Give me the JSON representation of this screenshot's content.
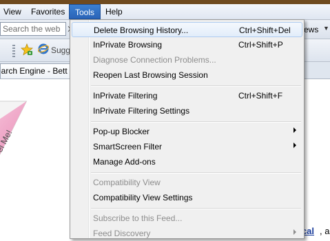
{
  "menubar": {
    "items": [
      {
        "label": "View"
      },
      {
        "label": "Favorites"
      },
      {
        "label": "Tools"
      },
      {
        "label": "Help"
      }
    ]
  },
  "toolbar": {
    "search_placeholder": "Search the web",
    "news_label": "ews",
    "favorites_suggestion": "Sugg"
  },
  "tab": {
    "title": "earch Engine - Bett"
  },
  "page": {
    "peel_text": "el Me!",
    "link_text": "ocal",
    "link_tail": ", a"
  },
  "tools_menu": {
    "items": [
      {
        "label": "Delete Browsing History...",
        "shortcut": "Ctrl+Shift+Del",
        "disabled": false,
        "highlighted": true,
        "submenu": false
      },
      {
        "label": "InPrivate Browsing",
        "shortcut": "Ctrl+Shift+P",
        "disabled": false,
        "highlighted": false,
        "submenu": false
      },
      {
        "label": "Diagnose Connection Problems...",
        "shortcut": "",
        "disabled": true,
        "highlighted": false,
        "submenu": false
      },
      {
        "label": "Reopen Last Browsing Session",
        "shortcut": "",
        "disabled": false,
        "highlighted": false,
        "submenu": false
      },
      {
        "label": "InPrivate Filtering",
        "shortcut": "Ctrl+Shift+F",
        "disabled": false,
        "highlighted": false,
        "submenu": false
      },
      {
        "label": "InPrivate Filtering Settings",
        "shortcut": "",
        "disabled": false,
        "highlighted": false,
        "submenu": false
      },
      {
        "label": "Pop-up Blocker",
        "shortcut": "",
        "disabled": false,
        "highlighted": false,
        "submenu": true
      },
      {
        "label": "SmartScreen Filter",
        "shortcut": "",
        "disabled": false,
        "highlighted": false,
        "submenu": true
      },
      {
        "label": "Manage Add-ons",
        "shortcut": "",
        "disabled": false,
        "highlighted": false,
        "submenu": false
      },
      {
        "label": "Compatibility View",
        "shortcut": "",
        "disabled": true,
        "highlighted": false,
        "submenu": false
      },
      {
        "label": "Compatibility View Settings",
        "shortcut": "",
        "disabled": false,
        "highlighted": false,
        "submenu": false
      },
      {
        "label": "Subscribe to this Feed...",
        "shortcut": "",
        "disabled": true,
        "highlighted": false,
        "submenu": false
      },
      {
        "label": "Feed Discovery",
        "shortcut": "",
        "disabled": true,
        "highlighted": false,
        "submenu": true
      }
    ]
  },
  "colors": {
    "menu_active_bg": "#2a64b8",
    "disabled_text": "#8d8d8d",
    "link": "#1a3d9b"
  }
}
